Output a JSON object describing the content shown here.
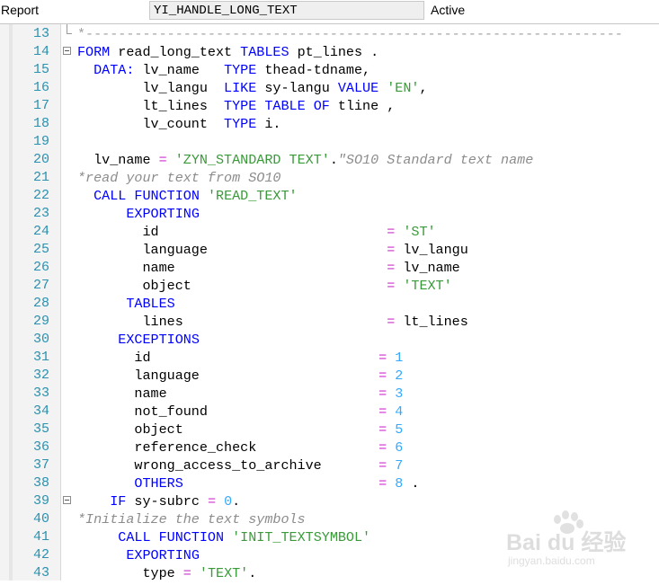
{
  "header": {
    "object_type": "Report",
    "object_name": "YI_HANDLE_LONG_TEXT",
    "status": "Active"
  },
  "editor": {
    "lines": [
      {
        "n": "13",
        "fold": "end",
        "tokens": [
          {
            "t": "*------------------------------------------------------------------",
            "c": "dash"
          }
        ]
      },
      {
        "n": "14",
        "fold": "open",
        "tokens": [
          {
            "t": "FORM",
            "c": "kw"
          },
          {
            "t": " read_long_text "
          },
          {
            "t": "TABLES",
            "c": "kw"
          },
          {
            "t": " pt_lines ."
          }
        ]
      },
      {
        "n": "15",
        "tokens": [
          {
            "t": "  "
          },
          {
            "t": "DATA:",
            "c": "kw"
          },
          {
            "t": " lv_name   "
          },
          {
            "t": "TYPE",
            "c": "kw"
          },
          {
            "t": " thead-tdname,"
          }
        ]
      },
      {
        "n": "16",
        "tokens": [
          {
            "t": "        lv_langu  "
          },
          {
            "t": "LIKE",
            "c": "kw"
          },
          {
            "t": " sy-langu "
          },
          {
            "t": "VALUE",
            "c": "kw"
          },
          {
            "t": " "
          },
          {
            "t": "'EN'",
            "c": "str"
          },
          {
            "t": ","
          }
        ]
      },
      {
        "n": "17",
        "tokens": [
          {
            "t": "        lt_lines  "
          },
          {
            "t": "TYPE",
            "c": "kw"
          },
          {
            "t": " "
          },
          {
            "t": "TABLE",
            "c": "kw"
          },
          {
            "t": " "
          },
          {
            "t": "OF",
            "c": "kw"
          },
          {
            "t": " tline ,"
          }
        ]
      },
      {
        "n": "18",
        "tokens": [
          {
            "t": "        lv_count  "
          },
          {
            "t": "TYPE",
            "c": "kw"
          },
          {
            "t": " i."
          }
        ]
      },
      {
        "n": "19",
        "tokens": []
      },
      {
        "n": "20",
        "tokens": [
          {
            "t": "  lv_name "
          },
          {
            "t": "=",
            "c": "op"
          },
          {
            "t": " "
          },
          {
            "t": "'ZYN_STANDARD TEXT'",
            "c": "str"
          },
          {
            "t": "."
          },
          {
            "t": "\"SO10 Standard text name",
            "c": "cm"
          }
        ]
      },
      {
        "n": "21",
        "tokens": [
          {
            "t": "*read your text from SO10",
            "c": "cm"
          }
        ]
      },
      {
        "n": "22",
        "tokens": [
          {
            "t": "  "
          },
          {
            "t": "CALL FUNCTION",
            "c": "kw"
          },
          {
            "t": " "
          },
          {
            "t": "'READ_TEXT'",
            "c": "str"
          }
        ]
      },
      {
        "n": "23",
        "tokens": [
          {
            "t": "      "
          },
          {
            "t": "EXPORTING",
            "c": "kw"
          }
        ]
      },
      {
        "n": "24",
        "tokens": [
          {
            "t": "        id                            "
          },
          {
            "t": "=",
            "c": "op"
          },
          {
            "t": " "
          },
          {
            "t": "'ST'",
            "c": "str"
          }
        ]
      },
      {
        "n": "25",
        "tokens": [
          {
            "t": "        language                      "
          },
          {
            "t": "=",
            "c": "op"
          },
          {
            "t": " lv_langu"
          }
        ]
      },
      {
        "n": "26",
        "tokens": [
          {
            "t": "        name                          "
          },
          {
            "t": "=",
            "c": "op"
          },
          {
            "t": " lv_name"
          }
        ]
      },
      {
        "n": "27",
        "tokens": [
          {
            "t": "        object                        "
          },
          {
            "t": "=",
            "c": "op"
          },
          {
            "t": " "
          },
          {
            "t": "'TEXT'",
            "c": "str"
          }
        ]
      },
      {
        "n": "28",
        "tokens": [
          {
            "t": "      "
          },
          {
            "t": "TABLES",
            "c": "kw"
          }
        ]
      },
      {
        "n": "29",
        "tokens": [
          {
            "t": "        lines                         "
          },
          {
            "t": "=",
            "c": "op"
          },
          {
            "t": " lt_lines"
          }
        ]
      },
      {
        "n": "30",
        "tokens": [
          {
            "t": "     "
          },
          {
            "t": "EXCEPTIONS",
            "c": "kw"
          }
        ]
      },
      {
        "n": "31",
        "tokens": [
          {
            "t": "       id                            "
          },
          {
            "t": "=",
            "c": "op"
          },
          {
            "t": " "
          },
          {
            "t": "1",
            "c": "num"
          }
        ]
      },
      {
        "n": "32",
        "tokens": [
          {
            "t": "       language                      "
          },
          {
            "t": "=",
            "c": "op"
          },
          {
            "t": " "
          },
          {
            "t": "2",
            "c": "num"
          }
        ]
      },
      {
        "n": "33",
        "tokens": [
          {
            "t": "       name                          "
          },
          {
            "t": "=",
            "c": "op"
          },
          {
            "t": " "
          },
          {
            "t": "3",
            "c": "num"
          }
        ]
      },
      {
        "n": "34",
        "tokens": [
          {
            "t": "       not_found                     "
          },
          {
            "t": "=",
            "c": "op"
          },
          {
            "t": " "
          },
          {
            "t": "4",
            "c": "num"
          }
        ]
      },
      {
        "n": "35",
        "tokens": [
          {
            "t": "       object                        "
          },
          {
            "t": "=",
            "c": "op"
          },
          {
            "t": " "
          },
          {
            "t": "5",
            "c": "num"
          }
        ]
      },
      {
        "n": "36",
        "tokens": [
          {
            "t": "       reference_check               "
          },
          {
            "t": "=",
            "c": "op"
          },
          {
            "t": " "
          },
          {
            "t": "6",
            "c": "num"
          }
        ]
      },
      {
        "n": "37",
        "tokens": [
          {
            "t": "       wrong_access_to_archive       "
          },
          {
            "t": "=",
            "c": "op"
          },
          {
            "t": " "
          },
          {
            "t": "7",
            "c": "num"
          }
        ]
      },
      {
        "n": "38",
        "tokens": [
          {
            "t": "       "
          },
          {
            "t": "OTHERS",
            "c": "kw"
          },
          {
            "t": "                        "
          },
          {
            "t": "=",
            "c": "op"
          },
          {
            "t": " "
          },
          {
            "t": "8",
            "c": "num"
          },
          {
            "t": " ."
          }
        ]
      },
      {
        "n": "39",
        "fold": "open",
        "tokens": [
          {
            "t": "    "
          },
          {
            "t": "IF",
            "c": "kw"
          },
          {
            "t": " sy-subrc "
          },
          {
            "t": "=",
            "c": "op"
          },
          {
            "t": " "
          },
          {
            "t": "0",
            "c": "num"
          },
          {
            "t": "."
          }
        ]
      },
      {
        "n": "40",
        "tokens": [
          {
            "t": "*Initialize the text symbols",
            "c": "cm"
          }
        ]
      },
      {
        "n": "41",
        "tokens": [
          {
            "t": "     "
          },
          {
            "t": "CALL FUNCTION",
            "c": "kw"
          },
          {
            "t": " "
          },
          {
            "t": "'INIT_TEXTSYMBOL'",
            "c": "str"
          }
        ]
      },
      {
        "n": "42",
        "tokens": [
          {
            "t": "      "
          },
          {
            "t": "EXPORTING",
            "c": "kw"
          }
        ]
      },
      {
        "n": "43",
        "tokens": [
          {
            "t": "        type "
          },
          {
            "t": "=",
            "c": "op"
          },
          {
            "t": " "
          },
          {
            "t": "'TEXT'",
            "c": "str"
          },
          {
            "t": "."
          }
        ]
      }
    ]
  },
  "watermark": {
    "brand": "Bai du 经验",
    "url": "jingyan.baidu.com"
  },
  "colors": {
    "keyword": "#0000ff",
    "string": "#3a9a3a",
    "number": "#33aaff",
    "operator": "#cc33cc",
    "comment": "#8c8c8c",
    "line_number": "#2b91af"
  }
}
